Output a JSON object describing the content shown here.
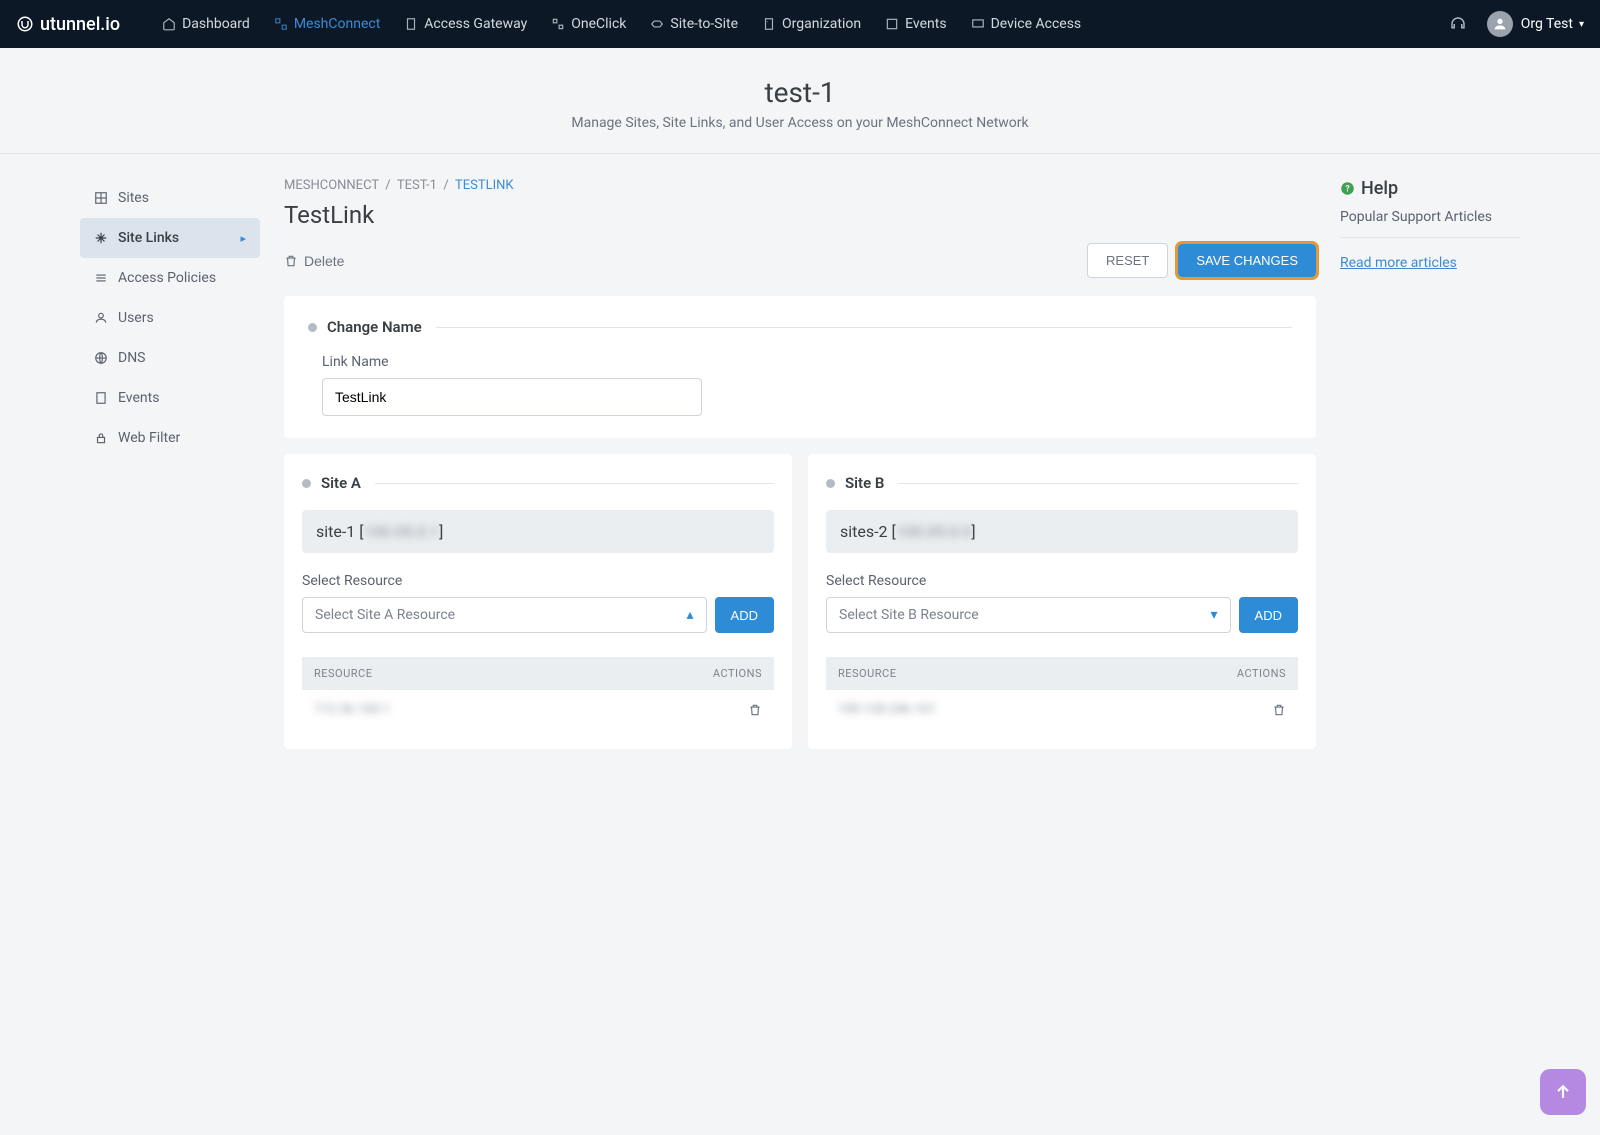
{
  "brand": "utunnel.io",
  "nav": [
    {
      "label": "Dashboard",
      "active": false
    },
    {
      "label": "MeshConnect",
      "active": true
    },
    {
      "label": "Access Gateway",
      "active": false
    },
    {
      "label": "OneClick",
      "active": false
    },
    {
      "label": "Site-to-Site",
      "active": false
    },
    {
      "label": "Organization",
      "active": false
    },
    {
      "label": "Events",
      "active": false
    },
    {
      "label": "Device Access",
      "active": false
    }
  ],
  "user_name": "Org Test",
  "page_title": "test-1",
  "page_sub": "Manage Sites, Site Links, and User Access on your MeshConnect Network",
  "sidebar": [
    {
      "label": "Sites"
    },
    {
      "label": "Site Links"
    },
    {
      "label": "Access Policies"
    },
    {
      "label": "Users"
    },
    {
      "label": "DNS"
    },
    {
      "label": "Events"
    },
    {
      "label": "Web Filter"
    }
  ],
  "breadcrumb": {
    "a": "MESHCONNECT",
    "b": "TEST-1",
    "c": "TESTLINK"
  },
  "content_title": "TestLink",
  "delete_label": "Delete",
  "reset_label": "RESET",
  "save_label": "SAVE CHANGES",
  "change_name_label": "Change Name",
  "link_name_label": "Link Name",
  "link_name_value": "TestLink",
  "site_a": {
    "title": "Site A",
    "name_prefix": "site-1 [",
    "name_blur": "100.05.0.1",
    "name_suffix": "]",
    "select_label": "Select Resource",
    "select_placeholder": "Select Site A Resource",
    "add_label": "ADD",
    "col_resource": "RESOURCE",
    "col_actions": "ACTIONS",
    "row_blur": "112.36.160.1"
  },
  "site_b": {
    "title": "Site B",
    "name_prefix": "sites-2 [",
    "name_blur": "100.05.0.0",
    "name_suffix": "]",
    "select_label": "Select Resource",
    "select_placeholder": "Select Site B Resource",
    "add_label": "ADD",
    "col_resource": "RESOURCE",
    "col_actions": "ACTIONS",
    "row_blur": "100.128.246.161"
  },
  "help": {
    "title": "Help",
    "sub": "Popular Support Articles",
    "link": "Read more articles"
  }
}
